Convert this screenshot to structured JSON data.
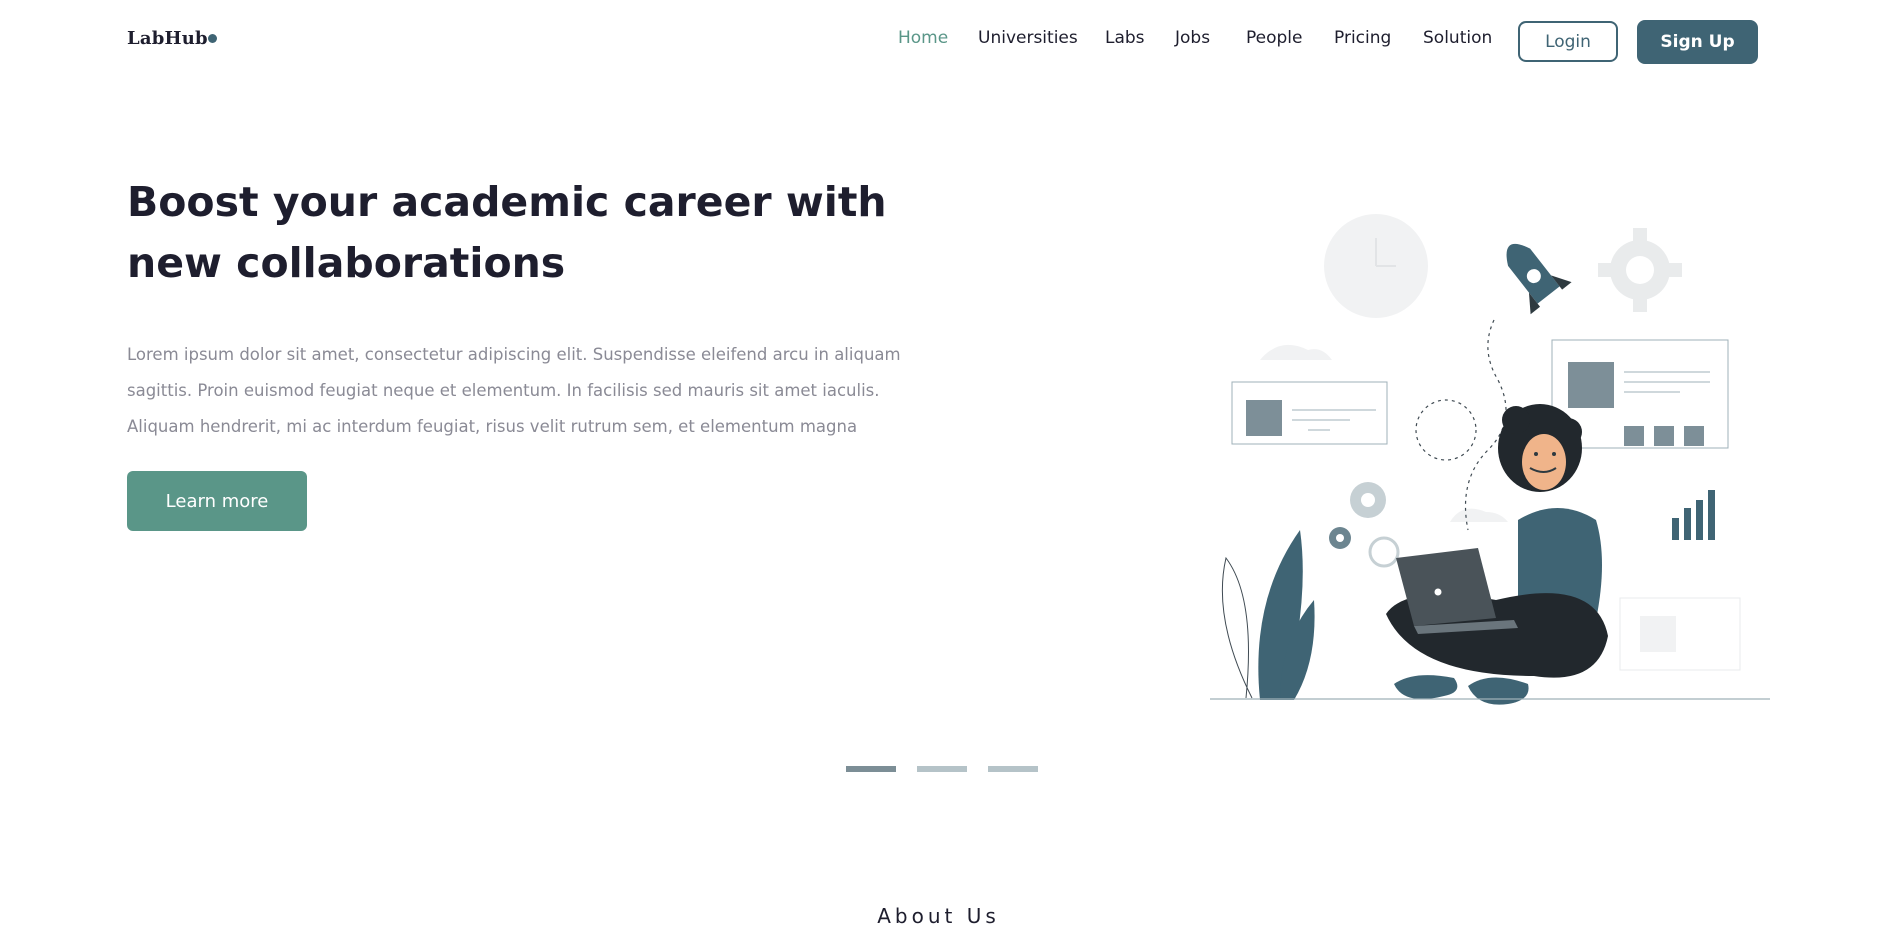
{
  "brand": {
    "name": "LabHub"
  },
  "nav": {
    "items": [
      {
        "label": "Home",
        "active": true
      },
      {
        "label": "Universities",
        "active": false
      },
      {
        "label": "Labs",
        "active": false
      },
      {
        "label": "Jobs",
        "active": false
      },
      {
        "label": "People",
        "active": false
      },
      {
        "label": "Pricing",
        "active": false
      },
      {
        "label": "Solution",
        "active": false
      }
    ],
    "login_label": "Login",
    "signup_label": "Sign Up"
  },
  "hero": {
    "title": "Boost your academic career with new collaborations",
    "description": "Lorem ipsum dolor sit amet, consectetur adipiscing elit. Suspendisse eleifend arcu in aliquam sagittis. Proin euismod feugiat neque et elementum. In facilisis sed mauris sit amet iaculis. Aliquam hendrerit, mi ac interdum feugiat, risus velit rutrum sem, et elementum magna",
    "cta_label": "Learn more"
  },
  "carousel": {
    "slides": 3,
    "active_index": 0
  },
  "about": {
    "heading": "About Us"
  },
  "colors": {
    "accent": "#5a9688",
    "primary": "#3f6474",
    "heading": "#1e1e2e",
    "muted_text": "#8a8a95"
  }
}
